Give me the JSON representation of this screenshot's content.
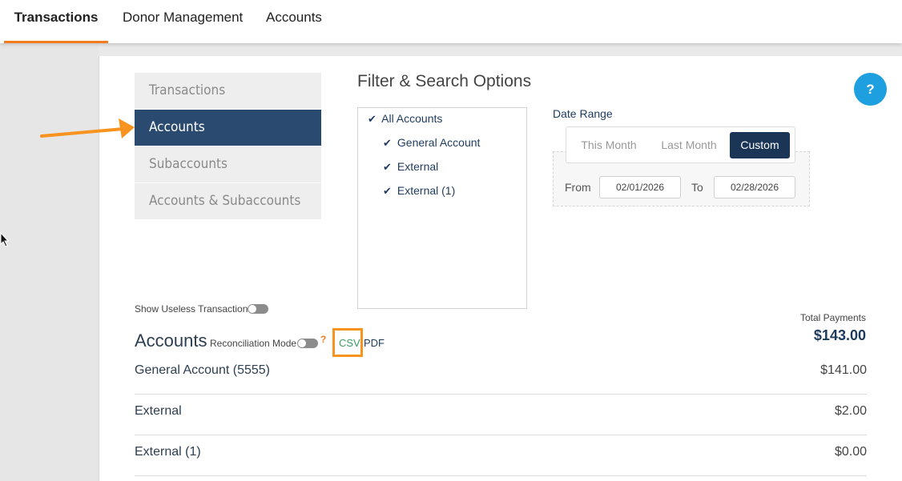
{
  "top_nav": {
    "tabs": [
      {
        "label": "Transactions",
        "active": true
      },
      {
        "label": "Donor Management",
        "active": false
      },
      {
        "label": "Accounts",
        "active": false
      }
    ]
  },
  "modes": [
    {
      "label": "Transactions",
      "active": false
    },
    {
      "label": "Accounts",
      "active": true
    },
    {
      "label": "Subaccounts",
      "active": false
    },
    {
      "label": "Accounts & Subaccounts",
      "active": false
    }
  ],
  "filter": {
    "title": "Filter & Search Options",
    "accounts": [
      {
        "label": "All Accounts",
        "checked": true
      },
      {
        "label": "General Account",
        "checked": true
      },
      {
        "label": "External",
        "checked": true
      },
      {
        "label": "External (1)",
        "checked": true
      }
    ],
    "date_range": {
      "label": "Date Range",
      "options": [
        "This Month",
        "Last Month",
        "Custom"
      ],
      "selected": "Custom",
      "from_label": "From",
      "from_value": "02/01/2026",
      "to_label": "To",
      "to_value": "02/28/2026"
    }
  },
  "help_label": "?",
  "show_useless_label": "Show Useless Transactions",
  "section": {
    "title": "Accounts",
    "reconciliation_label": "Reconciliation Mode",
    "reconciliation_help": "?",
    "csv_label": "CSV",
    "pdf_label": "PDF"
  },
  "totals": {
    "label": "Total Payments",
    "value": "$143.00"
  },
  "rows": [
    {
      "name": "General Account (5555)",
      "amount": "$141.00"
    },
    {
      "name": "External",
      "amount": "$2.00"
    },
    {
      "name": "External (1)",
      "amount": "$0.00"
    }
  ],
  "colors": {
    "accent_orange": "#f47b20",
    "nav_active_bg": "#2b4a6f",
    "help_blue": "#1ea0e0"
  }
}
